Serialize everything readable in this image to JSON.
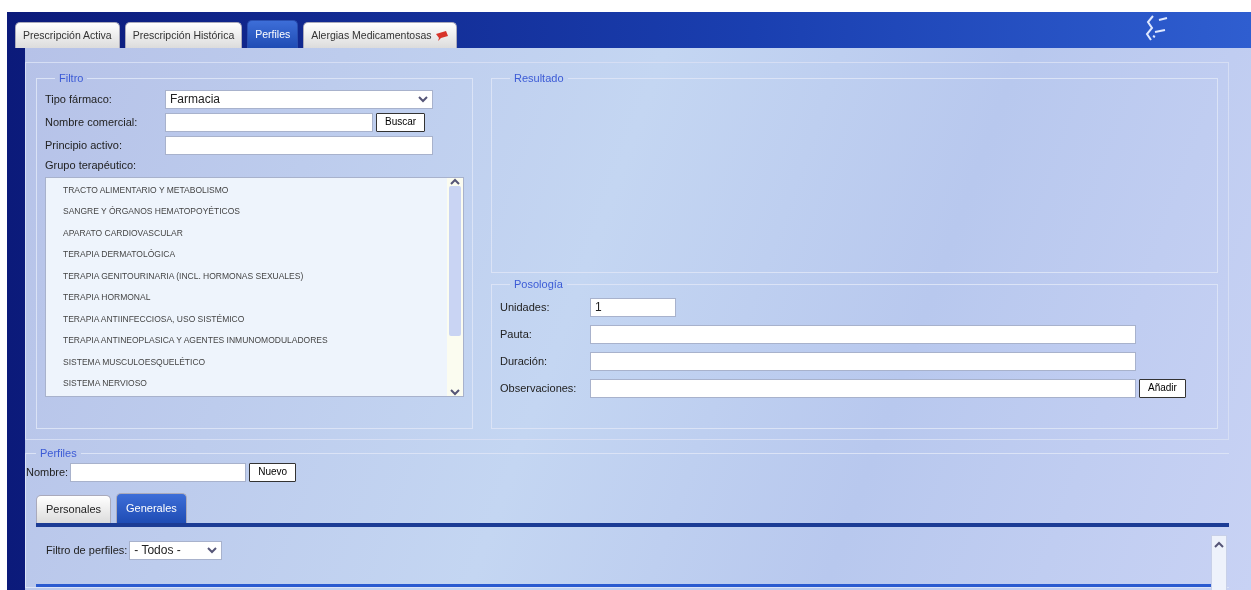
{
  "main_tabs": [
    {
      "label": "Prescripción Activa",
      "selected": false,
      "alert": false
    },
    {
      "label": "Prescripción Histórica",
      "selected": false,
      "alert": false
    },
    {
      "label": "Perfiles",
      "selected": true,
      "alert": false
    },
    {
      "label": "Alergias Medicamentosas",
      "selected": false,
      "alert": true
    }
  ],
  "filtro": {
    "legend": "Filtro",
    "fields": [
      {
        "kind": "select",
        "label": "Tipo fármaco:",
        "value": "Farmacia"
      },
      {
        "kind": "search",
        "label": "Nombre comercial:",
        "button": "Buscar"
      },
      {
        "kind": "text",
        "label": "Principio activo:"
      }
    ],
    "group_label": "Grupo terapéutico:",
    "group_items": [
      "TRACTO ALIMENTARIO Y METABOLISMO",
      "SANGRE Y ÓRGANOS HEMATOPOYÉTICOS",
      "APARATO CARDIOVASCULAR",
      "TERAPIA DERMATOLÓGICA",
      "TERAPIA GENITOURINARIA (INCL. HORMONAS SEXUALES)",
      "TERAPIA HORMONAL",
      "TERAPIA ANTIINFECCIOSA, USO SISTÉMICO",
      "TERAPIA ANTINEOPLASICA Y AGENTES INMUNOMODULADORES",
      "SISTEMA MUSCULOESQUELÉTICO",
      "SISTEMA NERVIOSO"
    ]
  },
  "resultado": {
    "legend": "Resultado"
  },
  "posologia": {
    "legend": "Posología",
    "fields": [
      {
        "kind": "short",
        "label": "Unidades:",
        "value": "1"
      },
      {
        "kind": "wide",
        "label": "Pauta:"
      },
      {
        "kind": "wide",
        "label": "Duración:"
      },
      {
        "kind": "wide",
        "label": "Observaciones:",
        "button": "Añadir"
      }
    ]
  },
  "perfiles": {
    "legend": "Perfiles",
    "name_label": "Nombre:",
    "button": "Nuevo",
    "tabs": [
      {
        "label": "Personales",
        "selected": false
      },
      {
        "label": "Generales",
        "selected": true
      }
    ],
    "filter_label": "Filtro de perfiles:",
    "filter_value": "- Todos -"
  }
}
